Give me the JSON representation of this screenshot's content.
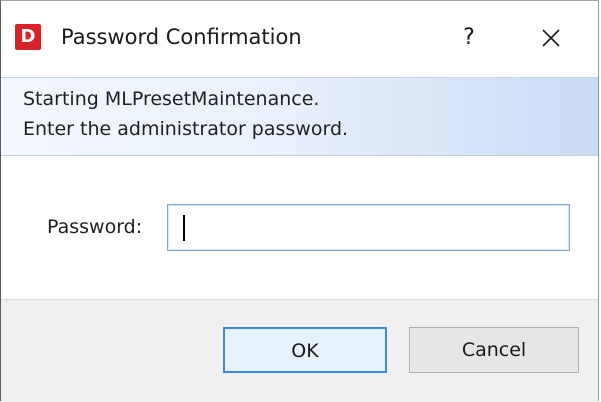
{
  "window": {
    "title": "Password Confirmation",
    "app_icon_letter": "D",
    "help_label": "?",
    "close_icon": "close-icon"
  },
  "header": {
    "line1": "Starting MLPresetMaintenance.",
    "line2": "Enter the administrator password."
  },
  "form": {
    "password_label": "Password:",
    "password_value": ""
  },
  "buttons": {
    "ok_label": "OK",
    "cancel_label": "Cancel"
  },
  "colors": {
    "app_icon": "#d8232a",
    "header_gradient_start": "#f3f7fd",
    "header_gradient_end": "#c9dcf4",
    "ok_border": "#3c8ad8"
  }
}
